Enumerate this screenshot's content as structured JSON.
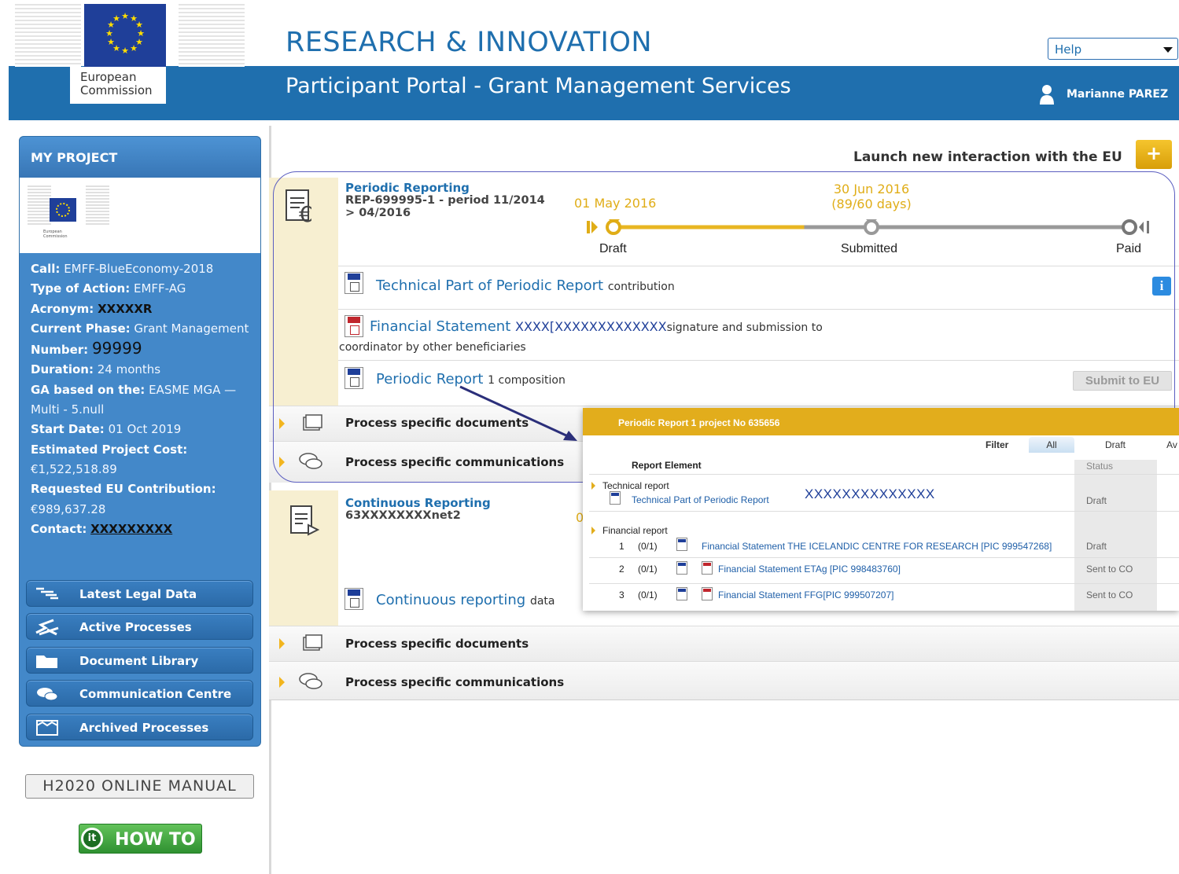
{
  "header": {
    "ec_label_line1": "European",
    "ec_label_line2": "Commission",
    "site_title": "RESEARCH & INNOVATION",
    "portal_title": "Participant Portal - Grant Management Services",
    "help_select": "Help",
    "user_name": "Marianne PAREZ"
  },
  "sidebar": {
    "title": "MY PROJECT",
    "info": [
      {
        "key": "Call:",
        "value": "EMFF-BlueEconomy-2018"
      },
      {
        "key": "Type of Action:",
        "value": "EMFF-AG"
      },
      {
        "key": "Acronym:",
        "value": "XXXXXR"
      },
      {
        "key": "Current Phase:",
        "value": "Grant Management"
      },
      {
        "key": "Number:",
        "value": "99999"
      },
      {
        "key": "Duration:",
        "value": "24 months"
      },
      {
        "key": "GA based on the:",
        "value": "EASME MGA — Multi - 5.null"
      },
      {
        "key": "Start Date:",
        "value": "01 Oct 2019"
      },
      {
        "key": "Estimated Project Cost:",
        "value": "€1,522,518.89"
      },
      {
        "key": "Requested EU Contribution:",
        "value": "€989,637.28"
      },
      {
        "key": "Contact:",
        "value": "XXXXXXXXX"
      }
    ],
    "buttons": [
      {
        "label": "Latest Legal Data",
        "icon": "legal-data-icon"
      },
      {
        "label": "Active Processes",
        "icon": "active-processes-icon"
      },
      {
        "label": "Document Library",
        "icon": "folder-icon"
      },
      {
        "label": "Communication Centre",
        "icon": "chat-icon"
      },
      {
        "label": "Archived Processes",
        "icon": "archive-icon"
      }
    ],
    "manual": "H2020 ONLINE MANUAL",
    "howto": "HOW TO",
    "howto_badge": "it"
  },
  "main": {
    "launch_label": "Launch new interaction with the EU",
    "launch_button": "+",
    "periodic": {
      "title": "Periodic Reporting",
      "sub1": "REP-699995-1 - period 11/2014",
      "sub2": "> 04/2016",
      "timeline": {
        "start_date": "01 May 2016",
        "submitted_date": "30 Jun 2016",
        "submitted_days": "(89/60 days)",
        "steps": [
          "Draft",
          "Submitted",
          "Paid"
        ],
        "progress": 0.33
      },
      "doc1_link": "Technical Part of Periodic Report",
      "doc1_note": "contribution",
      "doc2_link": "Financial Statement",
      "doc2_redact": "XXXX[XXXXXXXXXXXXX",
      "doc2_note": "signature and submission to",
      "doc2_note2": "coordinator by other beneficiaries",
      "doc3_link": "Periodic Report",
      "doc3_note": "1 composition",
      "submit_button": "Submit to EU",
      "info_button": "i"
    },
    "process_docs": "Process specific documents",
    "process_comms": "Process specific communications",
    "continuous": {
      "title": "Continuous Reporting",
      "sub1": "63XXXXXXXXnet2",
      "zero": "0",
      "doc_link": "Continuous reporting",
      "doc_note": "data"
    }
  },
  "popup": {
    "title": "Periodic Report 1 project No 635656",
    "filter_label": "Filter",
    "tabs": [
      "All",
      "Draft",
      "Av"
    ],
    "col_element": "Report Element",
    "col_status": "Status",
    "tech_group": "Technical report",
    "tech_item": "Technical Part of Periodic Report",
    "tech_redact": "XXXXXXXXXXXXXX",
    "tech_status": "Draft",
    "fin_group": "Financial report",
    "rows": [
      {
        "num": "1",
        "count": "(0/1)",
        "label": "Financial Statement THE ICELANDIC CENTRE FOR RESEARCH [PIC 999547268]",
        "status": "Draft"
      },
      {
        "num": "2",
        "count": "(0/1)",
        "label": "Financial Statement ETAg [PIC 998483760]",
        "status": "Sent to CO"
      },
      {
        "num": "3",
        "count": "(0/1)",
        "label": "Financial Statement FFG[PIC 999507207]",
        "status": "Sent to CO"
      }
    ]
  },
  "colors": {
    "brand_blue": "#1f6fae",
    "accent_gold": "#e2ad1c",
    "sidebar_blue": "#4388c9",
    "arrow_navy": "#2b2f7a"
  }
}
